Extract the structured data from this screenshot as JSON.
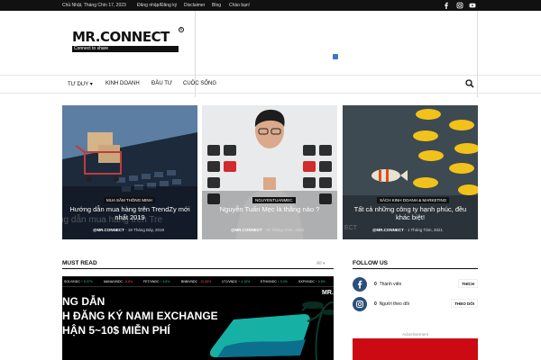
{
  "topbar": {
    "date": "Chủ Nhật, Tháng Chín 17, 2023",
    "links": [
      "Đăng nhập/Đăng ký",
      "Disclaimer",
      "Blog",
      "Chào bạn!"
    ],
    "social_icons": [
      "facebook-icon",
      "instagram-icon",
      "youtube-icon"
    ]
  },
  "logo": {
    "title": "MR.CONNECT",
    "tagline": "Connect to share"
  },
  "nav": {
    "items": [
      "TƯ DUY",
      "KINH DOANH",
      "ĐẦU TƯ",
      "CUỘC SỐNG"
    ],
    "search_icon": "search-icon"
  },
  "featured": [
    {
      "category": "MUA SẮM THÔNG MINH",
      "title": "Hướng dẫn mua hàng trên TrendZy mới nhất 2019",
      "author": "@MR.CONNECT",
      "date": "18 Tháng Bảy, 2019",
      "watermark": "ng dẫn mua hàng trên Tre"
    },
    {
      "category": "NGUYENTUANMEC",
      "title": "Nguyễn Tuấn Mẹc là thằng nào ?",
      "author": "@MR.CONNECT",
      "date": "16 Tháng Chín, 2020"
    },
    {
      "category": "SÁCH KINH DOANH & MARKETING",
      "title": "Tất cả những công ty hạnh phúc, đều khác biệt!",
      "author": "@MR.CONNECT",
      "date": "1 Tháng Tám, 2021",
      "watermark": "ECT"
    }
  ],
  "must_read": {
    "title": "MUST READ",
    "filter": "All"
  },
  "banner": {
    "ticker": [
      {
        "pair": "SOL/VNDC",
        "change": "+ 8.07%"
      },
      {
        "pair": "MANA/VNDC",
        "change": "- 8.8%",
        "neg": true
      },
      {
        "pair": "FET/VNDC",
        "change": "+ 5.8%"
      },
      {
        "pair": "BNB/VNDC",
        "change": "- 10.65%",
        "neg": true
      },
      {
        "pair": "LTC/VNDC",
        "change": "+ 4.18%"
      },
      {
        "pair": "ETH/VNDC",
        "change": "+ 5.3%"
      },
      {
        "pair": "SXP/VNDC",
        "change": "+ 6.5%"
      }
    ],
    "line1": "NG DẪN",
    "line2": "H ĐĂNG KÝ NAMI EXCHANGE",
    "line3": "HẬN 5~10$ MIỄN PHÍ",
    "brand": "MR."
  },
  "follow": {
    "title": "FOLLOW US",
    "rows": [
      {
        "icon": "facebook-icon",
        "count": "0",
        "label": "Thành viên",
        "button": "THÍCH"
      },
      {
        "icon": "instagram-icon",
        "count": "0",
        "label": "Người theo dõi",
        "button": "THEO DÕI"
      }
    ],
    "advertisement": "Advertisement"
  },
  "colors": {
    "accent": "#cc0a14",
    "topbar": "#111111",
    "banner_green": "#1fc77a"
  }
}
